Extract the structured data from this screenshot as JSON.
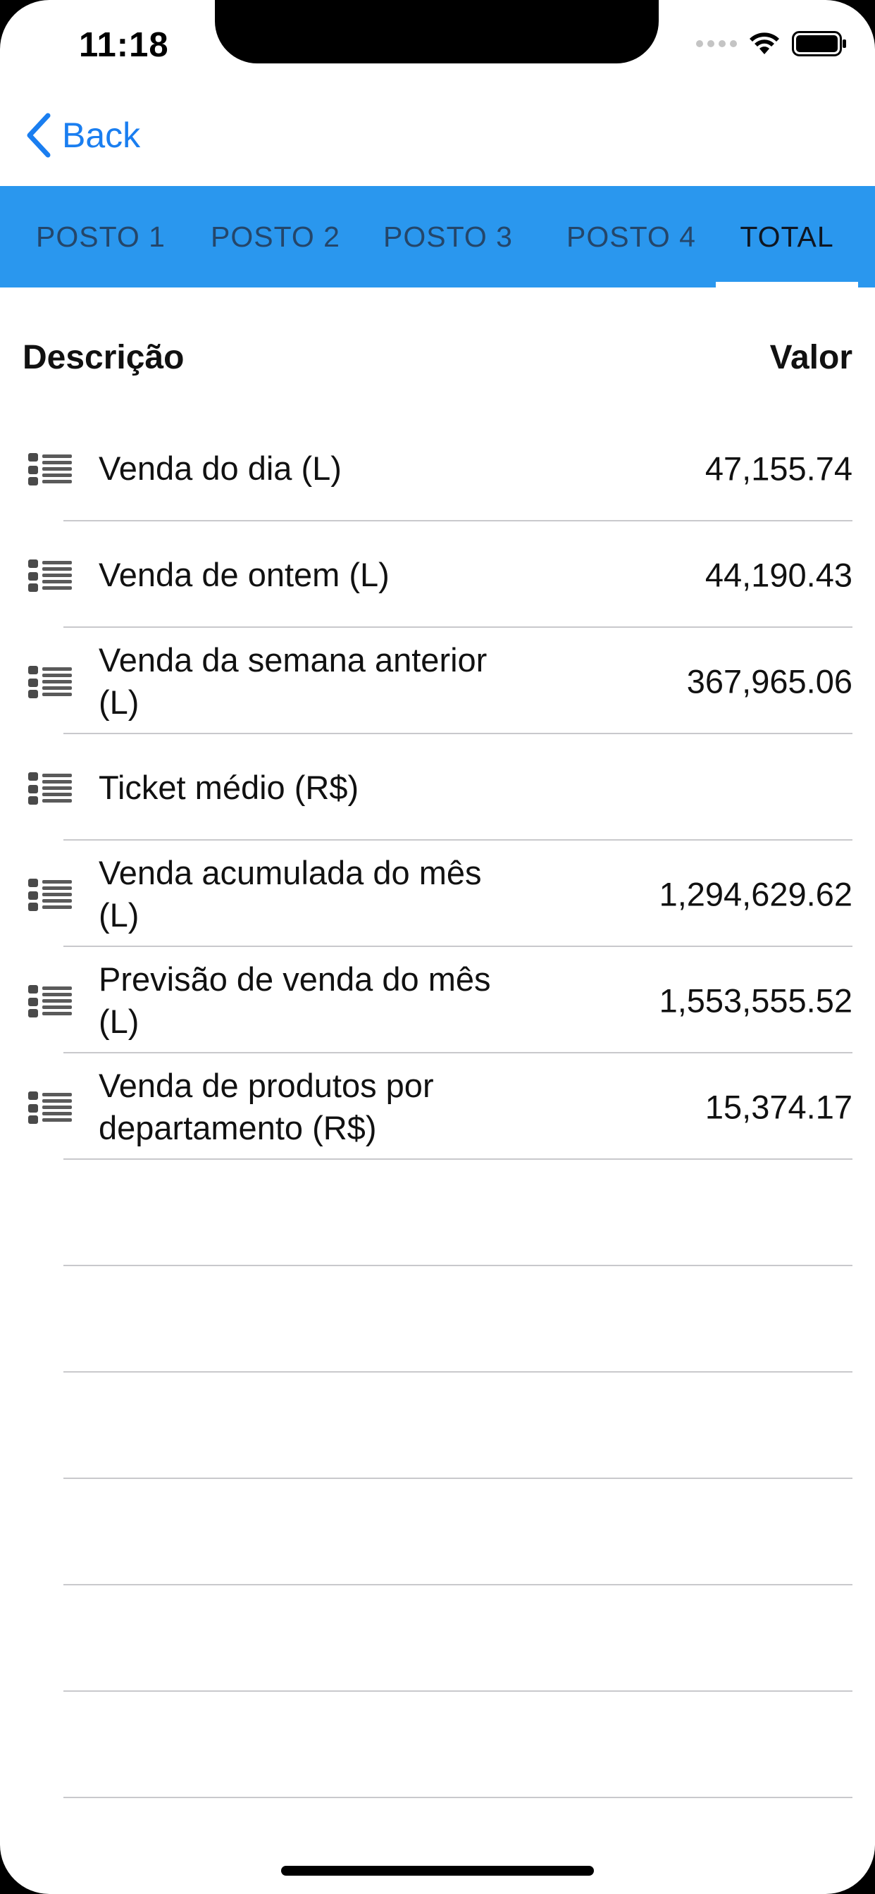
{
  "status_bar": {
    "time": "11:18"
  },
  "nav": {
    "back_label": "Back"
  },
  "tabs": [
    {
      "label": "POSTO 1",
      "active": false
    },
    {
      "label": "POSTO 2",
      "active": false
    },
    {
      "label": "POSTO 3",
      "active": false
    },
    {
      "label": "POSTO 4",
      "active": false
    },
    {
      "label": "TOTAL",
      "active": true
    }
  ],
  "table": {
    "col_description": "Descrição",
    "col_value": "Valor",
    "rows": [
      {
        "label": "Venda do dia (L)",
        "value": "47,155.74"
      },
      {
        "label": "Venda de ontem (L)",
        "value": "44,190.43"
      },
      {
        "label": "Venda da semana anterior (L)",
        "value": "367,965.06"
      },
      {
        "label": "Ticket médio (R$)",
        "value": ""
      },
      {
        "label": "Venda acumulada do mês (L)",
        "value": "1,294,629.62"
      },
      {
        "label": "Previsão de venda do mês (L)",
        "value": "1,553,555.52"
      },
      {
        "label": "Venda de produtos por departamento (R$)",
        "value": "15,374.17"
      }
    ]
  },
  "colors": {
    "accent": "#2a97ee",
    "link": "#1a7ef0",
    "tab_text": "#24466a",
    "tab_active_text": "#0e1622",
    "separator": "#c9c9cc"
  },
  "icons": {
    "row_icon": "list-icon",
    "back_icon": "chevron-left-icon"
  }
}
